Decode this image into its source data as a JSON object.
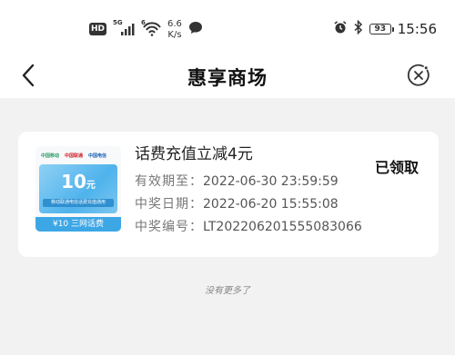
{
  "status_bar": {
    "hd_badge": "HD",
    "network_gen": "5G",
    "wifi_gen": "6",
    "speed_value": "6.6",
    "speed_unit": "K/s",
    "battery_level": "93",
    "time": "15:56",
    "icons": [
      "hd-icon",
      "signal-icon",
      "wifi-icon",
      "message-icon",
      "alarm-icon",
      "bluetooth-icon",
      "battery-icon"
    ]
  },
  "header": {
    "title": "惠享商场"
  },
  "coupons": [
    {
      "thumbnail": {
        "logos": [
          "中国移动",
          "中国联通",
          "中国电信"
        ],
        "amount": "10",
        "amount_unit": "元",
        "subtitle": "移动联通电信话费充值通用",
        "footer": "¥10 三网话费"
      },
      "title": "话费充值立减4元",
      "validity_label": "有效期至：",
      "validity_value": "2022-06-30  23:59:59",
      "win_date_label": "中奖日期：",
      "win_date_value": "2022-06-20  15:55:08",
      "win_no_label": "中奖编号：",
      "win_no_value": "LT20220620155508306​6",
      "status": "已领取"
    }
  ],
  "list_end_text": "没有更多了",
  "colors": {
    "background": "#f2f2f2",
    "card": "#ffffff",
    "thumb_blue": "#4fb3ec"
  }
}
